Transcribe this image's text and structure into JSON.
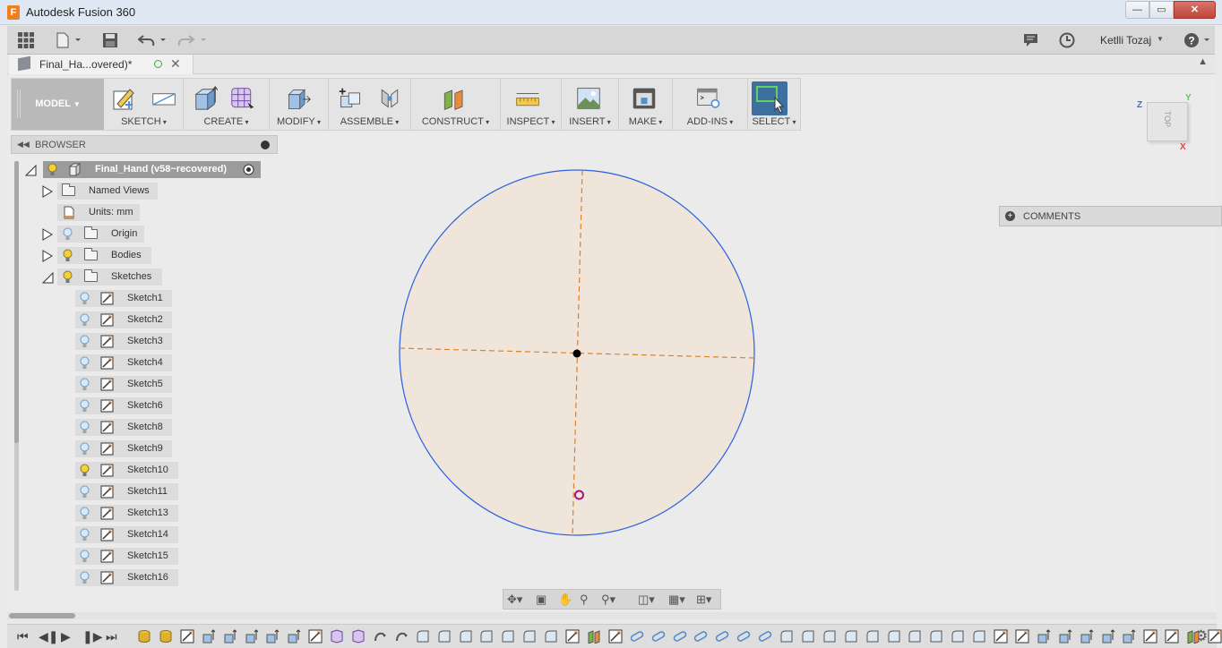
{
  "window": {
    "title": "Autodesk Fusion 360",
    "app_icon": "F",
    "minimize": "—",
    "maximize": "▭",
    "close": "✕"
  },
  "quick_access": {
    "user_name": "Ketlli Tozaj",
    "icons": [
      "apps-grid-icon",
      "file-menu-icon",
      "save-icon",
      "undo-icon",
      "redo-icon",
      "notifications-icon",
      "job-status-icon",
      "help-icon"
    ]
  },
  "document_tab": {
    "name": "Final_Ha...overed)*"
  },
  "toolbar": {
    "workspace": "MODEL",
    "groups": [
      {
        "label": "SKETCH"
      },
      {
        "label": "CREATE"
      },
      {
        "label": "MODIFY"
      },
      {
        "label": "ASSEMBLE"
      },
      {
        "label": "CONSTRUCT"
      },
      {
        "label": "INSPECT"
      },
      {
        "label": "INSERT"
      },
      {
        "label": "MAKE"
      },
      {
        "label": "ADD-INS"
      },
      {
        "label": "SELECT"
      }
    ]
  },
  "viewcube": {
    "face": "TOP",
    "axis_z": "Z",
    "axis_y": "Y",
    "axis_x": "X"
  },
  "comments": {
    "label": "COMMENTS"
  },
  "browser": {
    "title": "BROWSER",
    "root": "Final_Hand (v58~recovered)",
    "items": [
      {
        "label": "Named Views",
        "type": "folder"
      },
      {
        "label": "Units: mm",
        "type": "units"
      },
      {
        "label": "Origin",
        "type": "folder"
      },
      {
        "label": "Bodies",
        "type": "folder"
      },
      {
        "label": "Sketches",
        "type": "folder"
      }
    ],
    "sketches": [
      "Sketch1",
      "Sketch2",
      "Sketch3",
      "Sketch4",
      "Sketch5",
      "Sketch6",
      "Sketch8",
      "Sketch9",
      "Sketch10",
      "Sketch11",
      "Sketch13",
      "Sketch14",
      "Sketch15",
      "Sketch16"
    ]
  },
  "colors": {
    "sketch_fill": "#efe5db",
    "circle_stroke": "#2a5fe0",
    "construction_line": "#d9822b",
    "origin_point": "#000000",
    "sketch_point": "#a4167a",
    "bulb_on": "#f3d13b",
    "bulb_off": "#9ec7ea"
  }
}
